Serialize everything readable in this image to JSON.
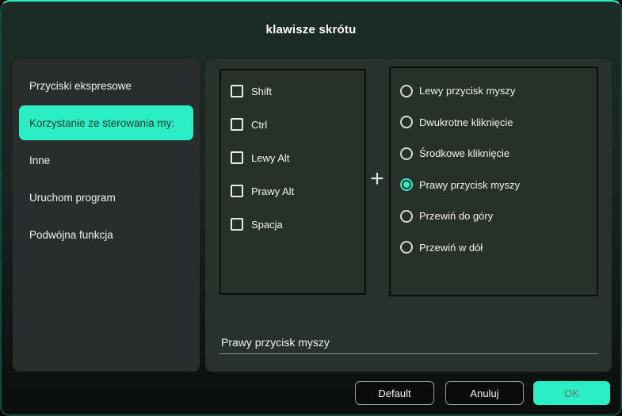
{
  "dialog": {
    "title": "klawisze skrótu"
  },
  "sidebar": {
    "items": [
      {
        "label": "Przyciski ekspresowe",
        "active": false
      },
      {
        "label": "Korzystanie ze sterowania my:",
        "active": true
      },
      {
        "label": "Inne",
        "active": false
      },
      {
        "label": "Uruchom program",
        "active": false
      },
      {
        "label": "Podwójna funkcja",
        "active": false
      }
    ]
  },
  "modifier_keys": {
    "items": [
      {
        "label": "Shift",
        "checked": false
      },
      {
        "label": "Ctrl",
        "checked": false
      },
      {
        "label": "Lewy Alt",
        "checked": false
      },
      {
        "label": "Prawy Alt",
        "checked": false
      },
      {
        "label": "Spacja",
        "checked": false
      }
    ]
  },
  "combiner": {
    "plus": "+"
  },
  "mouse_actions": {
    "items": [
      {
        "label": "Lewy przycisk myszy",
        "selected": false
      },
      {
        "label": "Dwukrotne kliknięcie",
        "selected": false
      },
      {
        "label": "Środkowe kliknięcie",
        "selected": false
      },
      {
        "label": "Prawy przycisk myszy",
        "selected": true
      },
      {
        "label": "Przewiń do góry",
        "selected": false
      },
      {
        "label": "Przewiń w dół",
        "selected": false
      }
    ]
  },
  "preview": {
    "value": "Prawy przycisk myszy"
  },
  "footer": {
    "buttons": [
      {
        "label": "Default"
      },
      {
        "label": "Anuluj"
      },
      {
        "label": "OK"
      }
    ]
  },
  "colors": {
    "accent": "#2BEFC4",
    "highlight_text": "#15332b",
    "panel_border": "#0b0e0d"
  }
}
